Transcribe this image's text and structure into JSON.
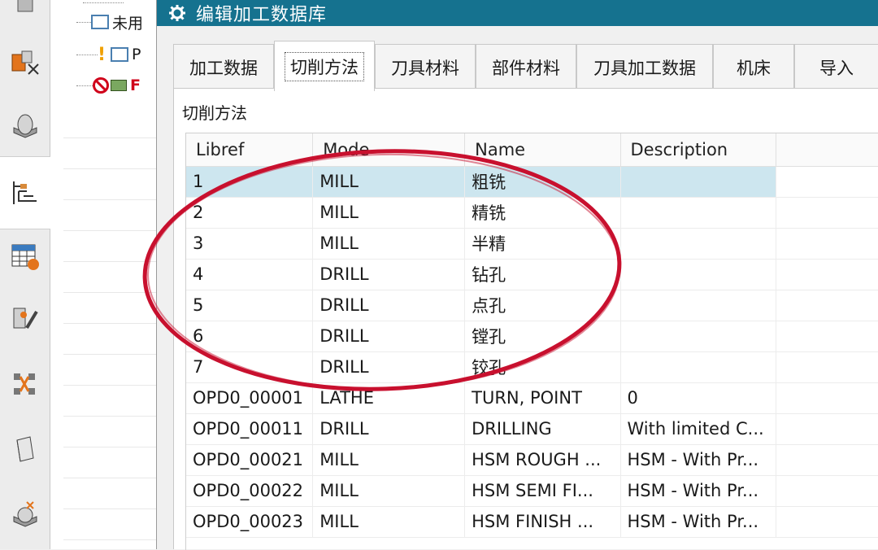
{
  "dialog": {
    "title": "编辑加工数据库",
    "tabs": [
      {
        "label": "加工数据"
      },
      {
        "label": "切削方法"
      },
      {
        "label": "刀具材料"
      },
      {
        "label": "部件材料"
      },
      {
        "label": "刀具加工数据"
      },
      {
        "label": "机床"
      },
      {
        "label": "导入"
      }
    ],
    "active_tab": "切削方法",
    "section_label": "切削方法",
    "table": {
      "columns": [
        "Libref",
        "Mode",
        "Name",
        "Description"
      ],
      "rows": [
        [
          "1",
          "MILL",
          "粗铣",
          ""
        ],
        [
          "2",
          "MILL",
          "精铣",
          ""
        ],
        [
          "3",
          "MILL",
          "半精",
          ""
        ],
        [
          "4",
          "DRILL",
          "钻孔",
          ""
        ],
        [
          "5",
          "DRILL",
          "点孔",
          ""
        ],
        [
          "6",
          "DRILL",
          "镗孔",
          ""
        ],
        [
          "7",
          "DRILL",
          "铰孔",
          ""
        ],
        [
          "OPD0_00001",
          "LATHE",
          "TURN, POINT",
          "0"
        ],
        [
          "OPD0_00011",
          "DRILL",
          "DRILLING",
          "With limited C..."
        ],
        [
          "OPD0_00021",
          "MILL",
          "HSM ROUGH ...",
          "HSM - With Pr..."
        ],
        [
          "OPD0_00022",
          "MILL",
          "HSM SEMI FI...",
          "HSM - With Pr..."
        ],
        [
          "OPD0_00023",
          "MILL",
          "HSM FINISH ...",
          "HSM - With Pr..."
        ]
      ],
      "selected_row": 0
    }
  },
  "nav_tree": {
    "items": [
      {
        "label": "未用",
        "icon": "folder-icon"
      },
      {
        "label": "P",
        "icon": "warning-folder-icon"
      },
      {
        "label": "F",
        "icon": "prohibited-operation-icon"
      }
    ]
  },
  "toolbar": {
    "icons": [
      "part-navigator-icon",
      "assembly-icon",
      "machine-tool-icon",
      "operation-navigator-icon",
      "table-icon",
      "tool-setting-icon",
      "process-icon",
      "library-icon",
      "feature-icon"
    ]
  },
  "colors": {
    "title_bar": "#15728f",
    "selected_row": "#cde6ef",
    "annotation": "#c8102e"
  }
}
